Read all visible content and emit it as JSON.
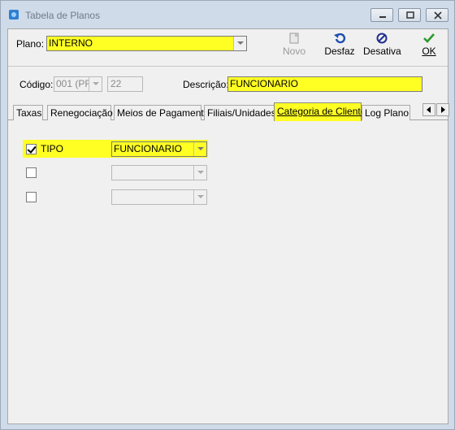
{
  "window": {
    "title": "Tabela de Planos",
    "minimize_icon": "minimize-icon",
    "maximize_icon": "maximize-icon",
    "close_icon": "close-icon"
  },
  "toolbar": {
    "plano_label": "Plano:",
    "plano_value": "INTERNO",
    "buttons": [
      {
        "label": "Novo",
        "icon": "new-document-icon",
        "enabled": false
      },
      {
        "label": "Desfaz",
        "icon": "undo-icon",
        "enabled": true
      },
      {
        "label": "Desativa",
        "icon": "disable-icon",
        "enabled": true
      },
      {
        "label": "OK",
        "icon": "checkmark-icon",
        "enabled": true
      }
    ]
  },
  "info": {
    "codigo_label": "Código:",
    "codigo_value": "001 (PR",
    "codigo_number": "22",
    "descricao_label": "Descrição:",
    "descricao_value": "FUNCIONARIO"
  },
  "tabs": [
    {
      "label": "Taxas",
      "active": false
    },
    {
      "label": "Renegociação",
      "active": false
    },
    {
      "label": "Meios de Pagamento",
      "active": false
    },
    {
      "label": "Filiais/Unidades",
      "active": false
    },
    {
      "label": "Categoria de Cliente",
      "active": true
    },
    {
      "label": "Log Plano",
      "active": false
    }
  ],
  "categoria": {
    "rows": [
      {
        "checked": true,
        "label": "TIPO",
        "value": "FUNCIONARIO"
      },
      {
        "checked": false,
        "label": "",
        "value": ""
      },
      {
        "checked": false,
        "label": "",
        "value": ""
      }
    ]
  },
  "colors": {
    "highlight": "#ffff24",
    "frame": "#cfdbe9",
    "client": "#f0f0f0"
  }
}
